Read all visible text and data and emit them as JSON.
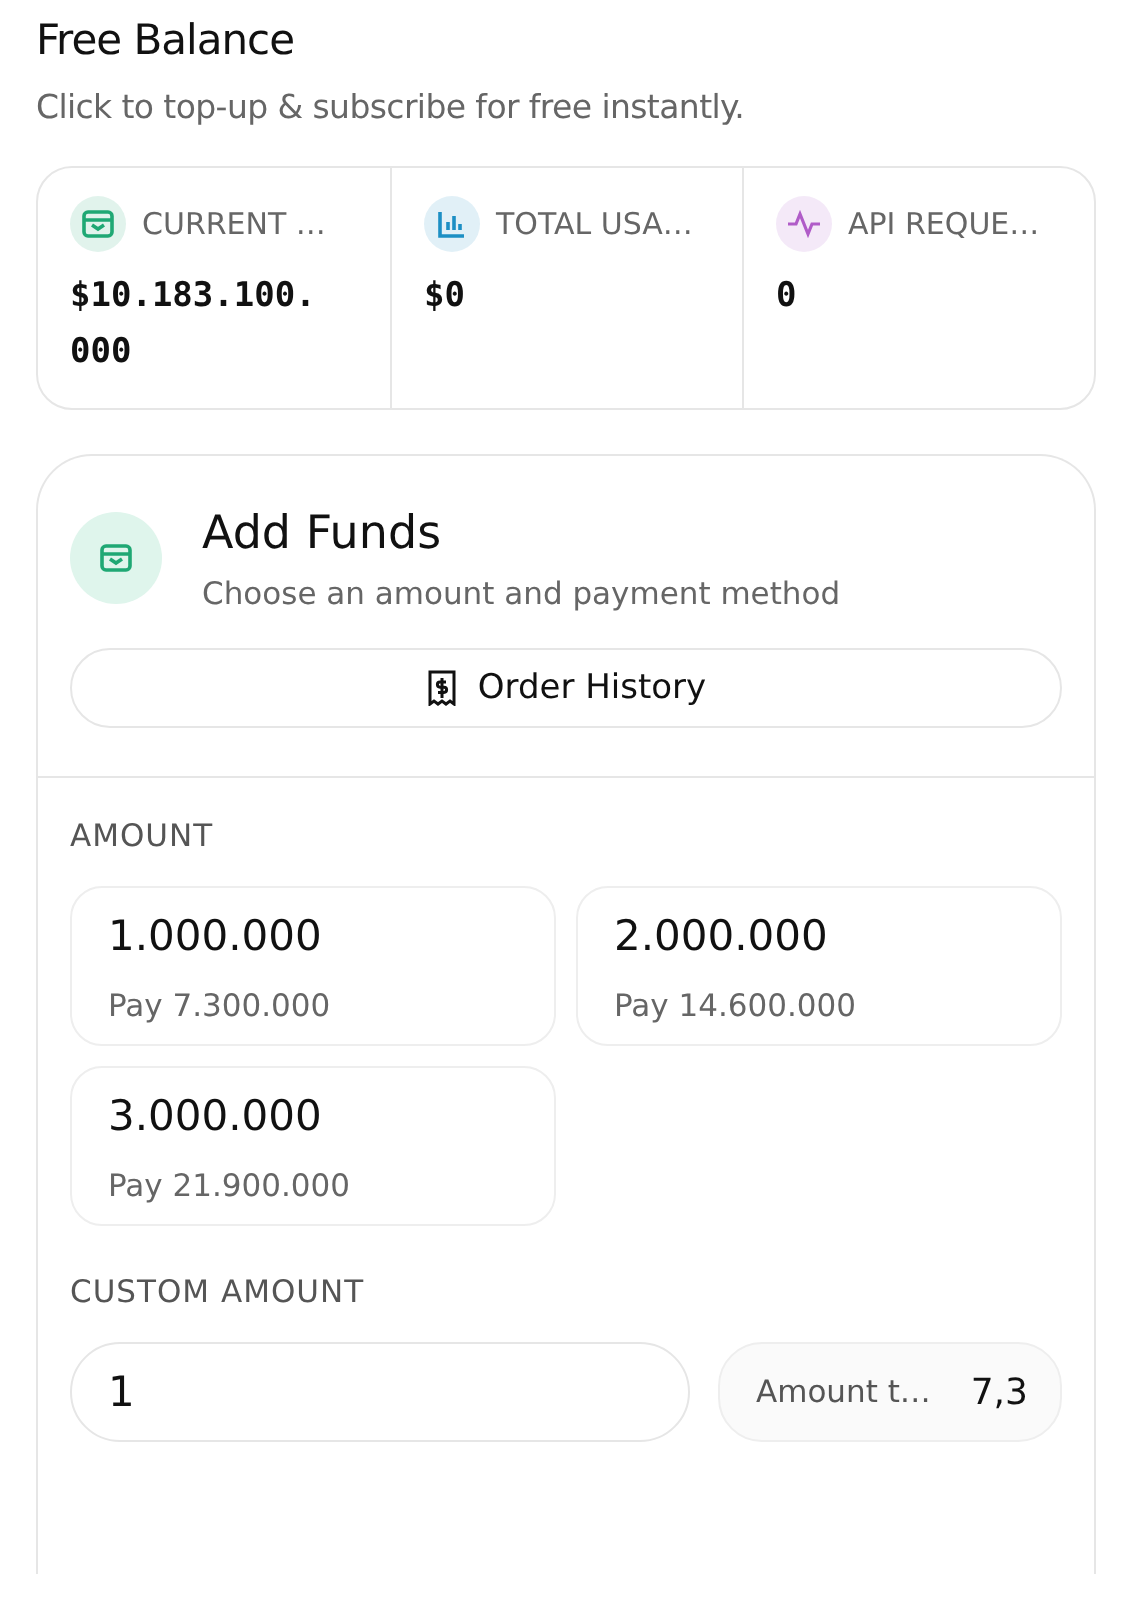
{
  "header": {
    "title": "Free Balance",
    "subtitle": "Click to top-up & subscribe for free instantly."
  },
  "stats": [
    {
      "label": "CURRENT …",
      "value": "$10.183.100.\n000",
      "color": "#1fa874"
    },
    {
      "label": "TOTAL USA…",
      "value": "$0",
      "color": "#1c8fc4"
    },
    {
      "label": "API REQUE…",
      "value": "0",
      "color": "#b05cc8"
    }
  ],
  "add_funds": {
    "title": "Add Funds",
    "subtitle": "Choose an amount and payment method",
    "order_history_button": "Order History",
    "amount_label": "AMOUNT",
    "amounts": [
      {
        "amount": "1.000.000",
        "pay": "Pay 7.300.000"
      },
      {
        "amount": "2.000.000",
        "pay": "Pay 14.600.000"
      },
      {
        "amount": "3.000.000",
        "pay": "Pay 21.900.000"
      }
    ],
    "custom_amount_label": "CUSTOM AMOUNT",
    "custom_amount_value": "1",
    "amount_to_pay_label": "Amount t…",
    "amount_to_pay_value": "7,3"
  }
}
